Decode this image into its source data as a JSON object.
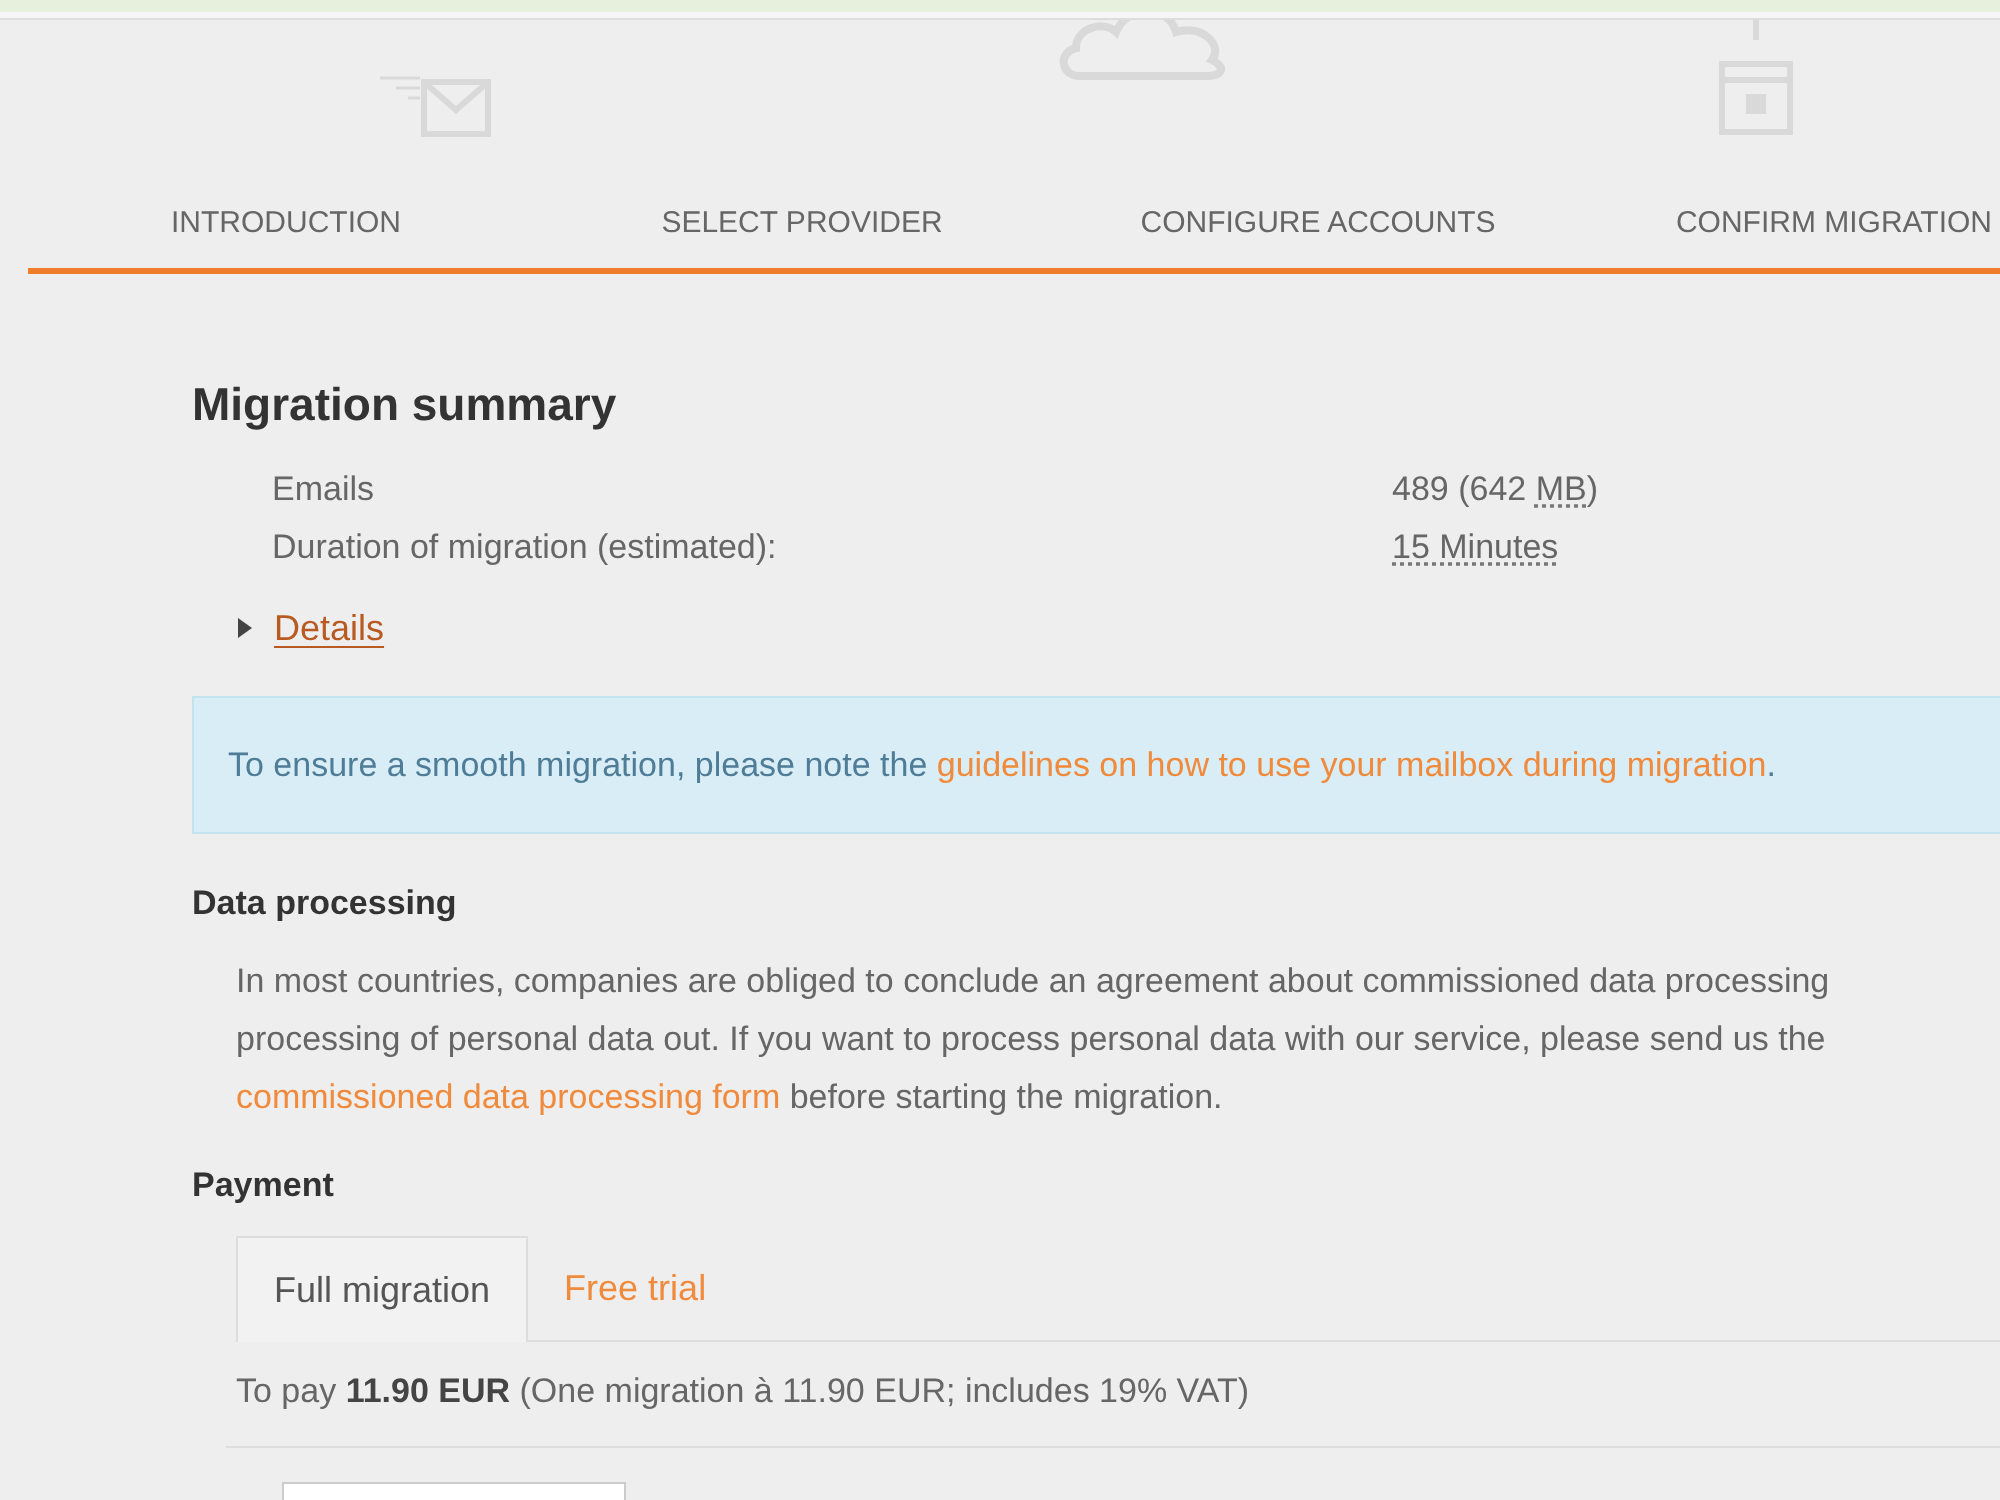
{
  "steps": [
    {
      "label": "INTRODUCTION",
      "done": true
    },
    {
      "label": "SELECT PROVIDER",
      "done": true
    },
    {
      "label": "CONFIGURE ACCOUNTS",
      "done": true
    },
    {
      "label": "CONFIRM MIGRATION",
      "done": true
    }
  ],
  "summary": {
    "title": "Migration summary",
    "rows": [
      {
        "label": "Emails",
        "value": [
          {
            "text": "489 (642 ",
            "abbr": false
          },
          {
            "text": "MB",
            "abbr": true
          },
          {
            "text": ")",
            "abbr": false
          }
        ]
      },
      {
        "label": "Duration of migration (estimated):",
        "value": [
          {
            "text": "15 Minutes",
            "abbr": true
          }
        ]
      }
    ],
    "details": {
      "label": "Details",
      "expanded": false
    }
  },
  "notice": {
    "text": "To ensure a smooth migration, please note the ",
    "link": "guidelines on how to use your mailbox during migration",
    "after": "."
  },
  "data_processing": {
    "title": "Data processing",
    "lines": [
      "In most countries, companies are obliged to conclude an agreement about commissioned data processing",
      "processing of personal data out. If you want to process personal data with our service, please send us the"
    ],
    "link": "commissioned data processing form",
    "after": " before starting the migration."
  },
  "payment": {
    "title": "Payment",
    "tabs": [
      {
        "label": "Full migration",
        "selected": true
      },
      {
        "label": "Free trial",
        "selected": false
      }
    ],
    "summary": "To pay **11.90 EUR** (One migration à 11.90 EUR; includes 19% VAT)"
  }
}
